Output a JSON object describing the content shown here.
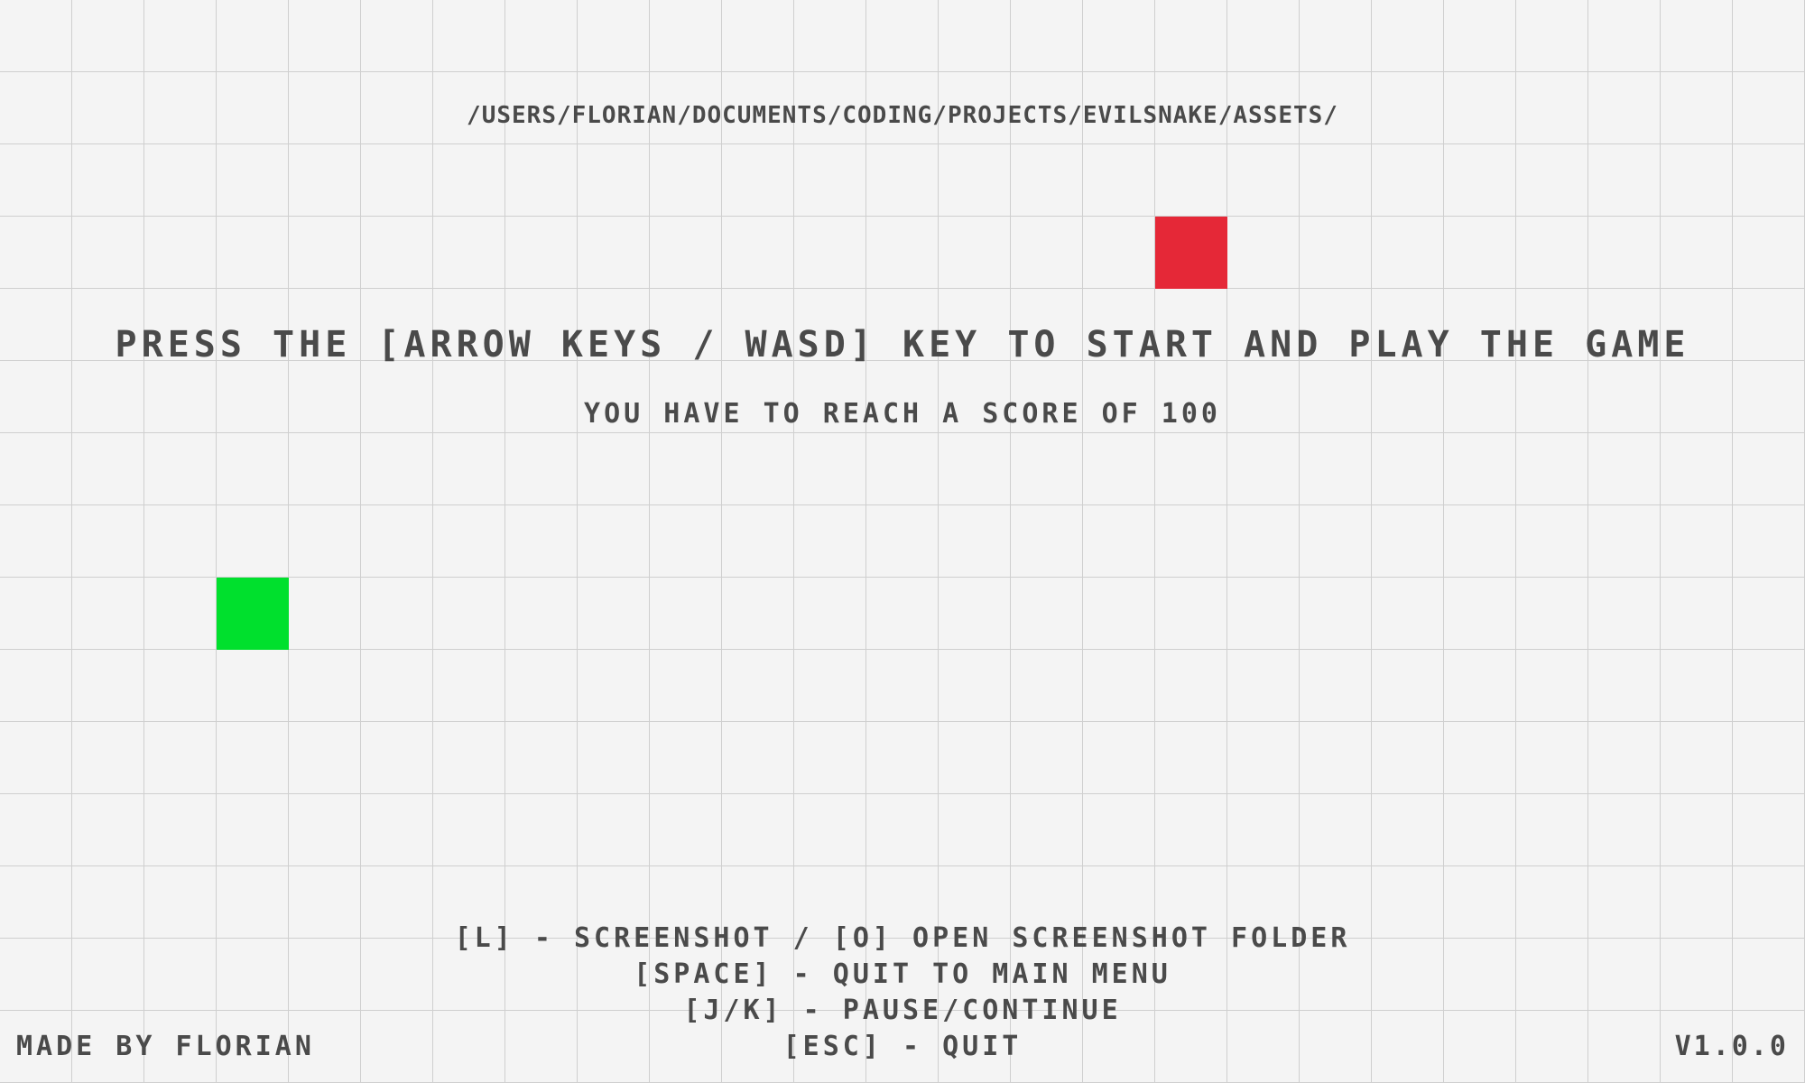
{
  "assets_path": "/USERS/FLORIAN/DOCUMENTS/CODING/PROJECTS/EVILSNAKE/ASSETS/",
  "headline": "PRESS THE [ARROW KEYS / WASD] KEY TO START AND PLAY THE GAME",
  "goal_text": "YOU HAVE TO REACH A SCORE OF 100",
  "controls": [
    "[L] - SCREENSHOT / [O] OPEN SCREENSHOT FOLDER",
    "[SPACE] - QUIT TO MAIN MENU",
    "[J/K] - PAUSE/CONTINUE",
    "[ESC] - QUIT"
  ],
  "credit": "MADE BY FLORIAN",
  "version": "V1.0.0",
  "colors": {
    "background": "#f4f4f4",
    "grid_line": "#cfcfcf",
    "text": "#4a4a4a",
    "food": "#e52837",
    "snake": "#00e02d"
  }
}
